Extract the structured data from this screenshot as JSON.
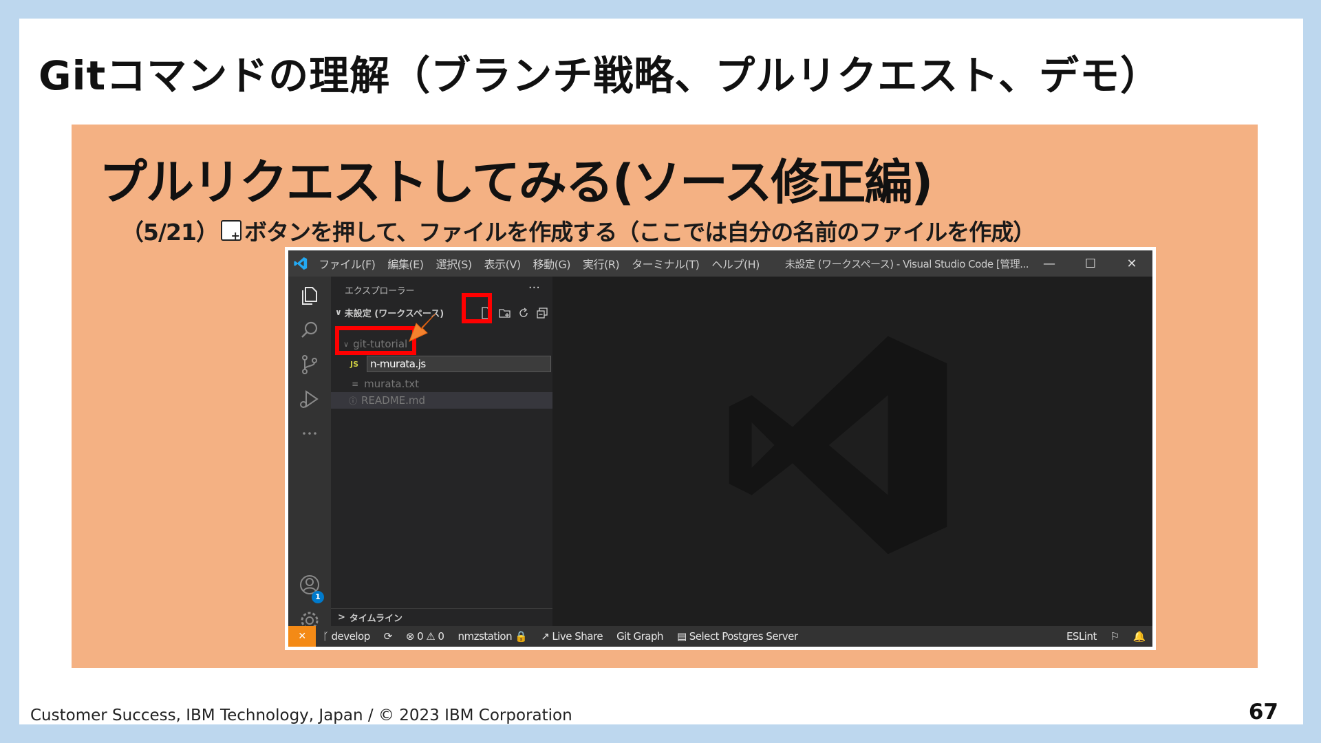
{
  "slide": {
    "title": "Gitコマンドの理解（ブランチ戦略、プルリクエスト、デモ）",
    "panel_title": "プルリクエストしてみる(ソース修正編)",
    "subtitle_prefix": "（5/21）",
    "subtitle_suffix": "ボタンを押して、ファイルを作成する（ここでは自分の名前のファイルを作成）",
    "footer": "Customer Success, IBM Technology, Japan / © 2023 IBM Corporation",
    "page_number": "67"
  },
  "vscode": {
    "menu": [
      "ファイル(F)",
      "編集(E)",
      "選択(S)",
      "表示(V)",
      "移動(G)",
      "実行(R)",
      "ターミナル(T)",
      "ヘルプ(H)"
    ],
    "window_title": "未設定 (ワークスペース) - Visual Studio Code [管理...",
    "window_controls": [
      "—",
      "☐",
      "✕"
    ],
    "sidebar": {
      "header": "エクスプローラー",
      "more": "···",
      "workspace": "未設定 (ワークスペース)",
      "folder": "git-tutorial",
      "new_file_name": "n-murata.js",
      "js_badge": "JS",
      "files": [
        "murata.txt",
        "README.md"
      ],
      "timeline": "タイムライン"
    },
    "statusbar": {
      "remote": "✕",
      "branch": "develop",
      "sync": "⟳",
      "errors": "⊗ 0",
      "warnings": "⚠ 0",
      "user": "nmzstation",
      "live_share": "Live Share",
      "git_graph": "Git Graph",
      "postgres": "Select Postgres Server",
      "eslint": "ESLint"
    },
    "colors": {
      "highlight": "#ff0000",
      "arrow": "#f4822e",
      "panel": "#f4b183",
      "remote": "#f48a16"
    }
  }
}
